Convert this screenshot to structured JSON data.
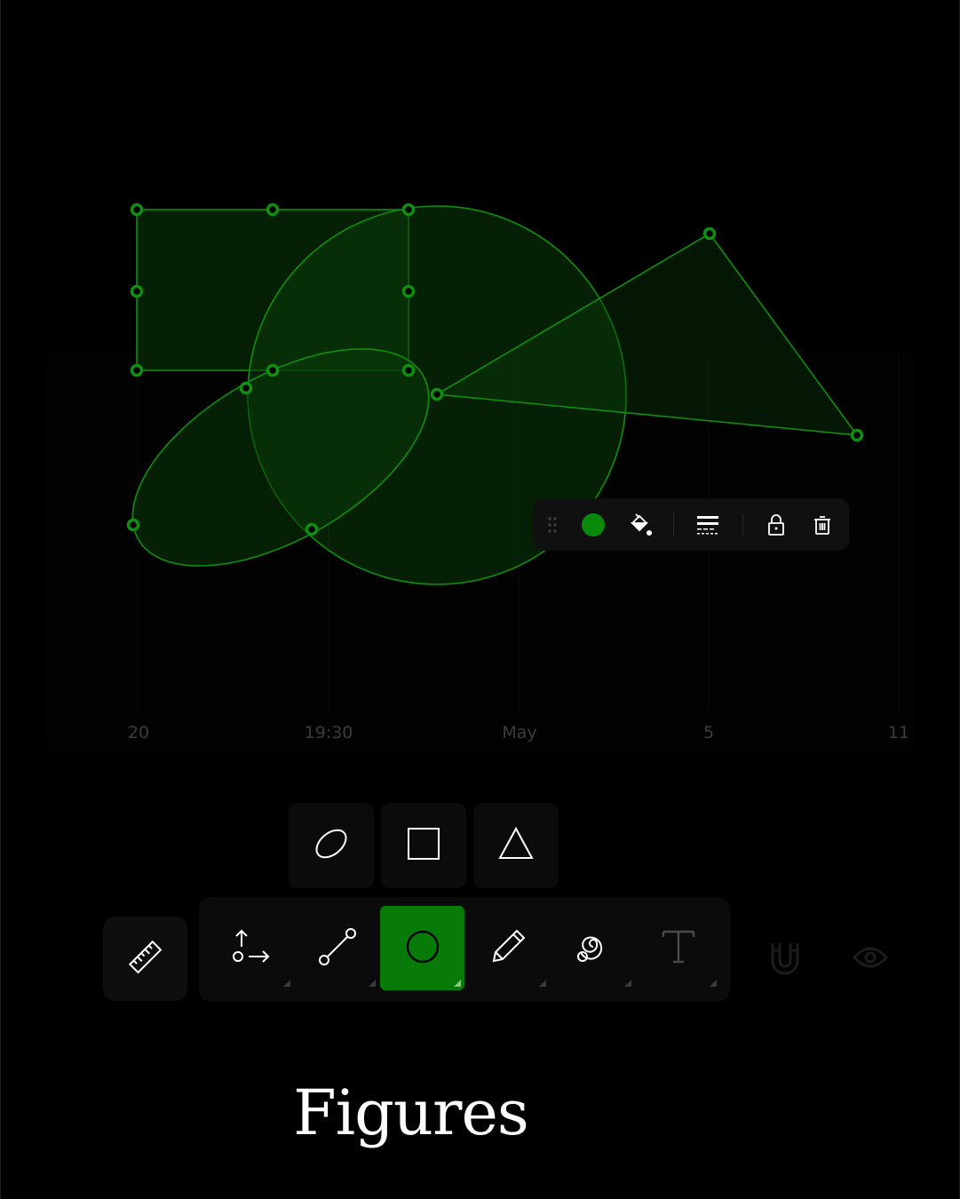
{
  "canvas": {
    "time_axis_labels": [
      "20",
      "19:30",
      "May",
      "5",
      "11"
    ],
    "stroke_color": "#0f8f0f",
    "fill_color": "#0a3a0a",
    "handle_color": "#0f8f0f"
  },
  "shape_toolbar": {
    "items": [
      "drag-handle-icon",
      "color-swatch",
      "fill-bucket-icon",
      "line-style-icon",
      "lock-icon",
      "delete-icon"
    ],
    "selected_color": "#0a8a0a"
  },
  "shape_submenu": {
    "items": [
      "ellipse-icon",
      "rectangle-icon",
      "triangle-icon"
    ]
  },
  "main_toolbar": {
    "tools": [
      "ruler-icon",
      "arrows-icon",
      "line-icon",
      "circle-icon",
      "pencil-icon",
      "spiral-icon",
      "text-icon",
      "magnet-icon",
      "eye-icon"
    ],
    "active_tool": "circle-icon",
    "active_color": "#077a07"
  },
  "caption": {
    "text": "Figures"
  }
}
